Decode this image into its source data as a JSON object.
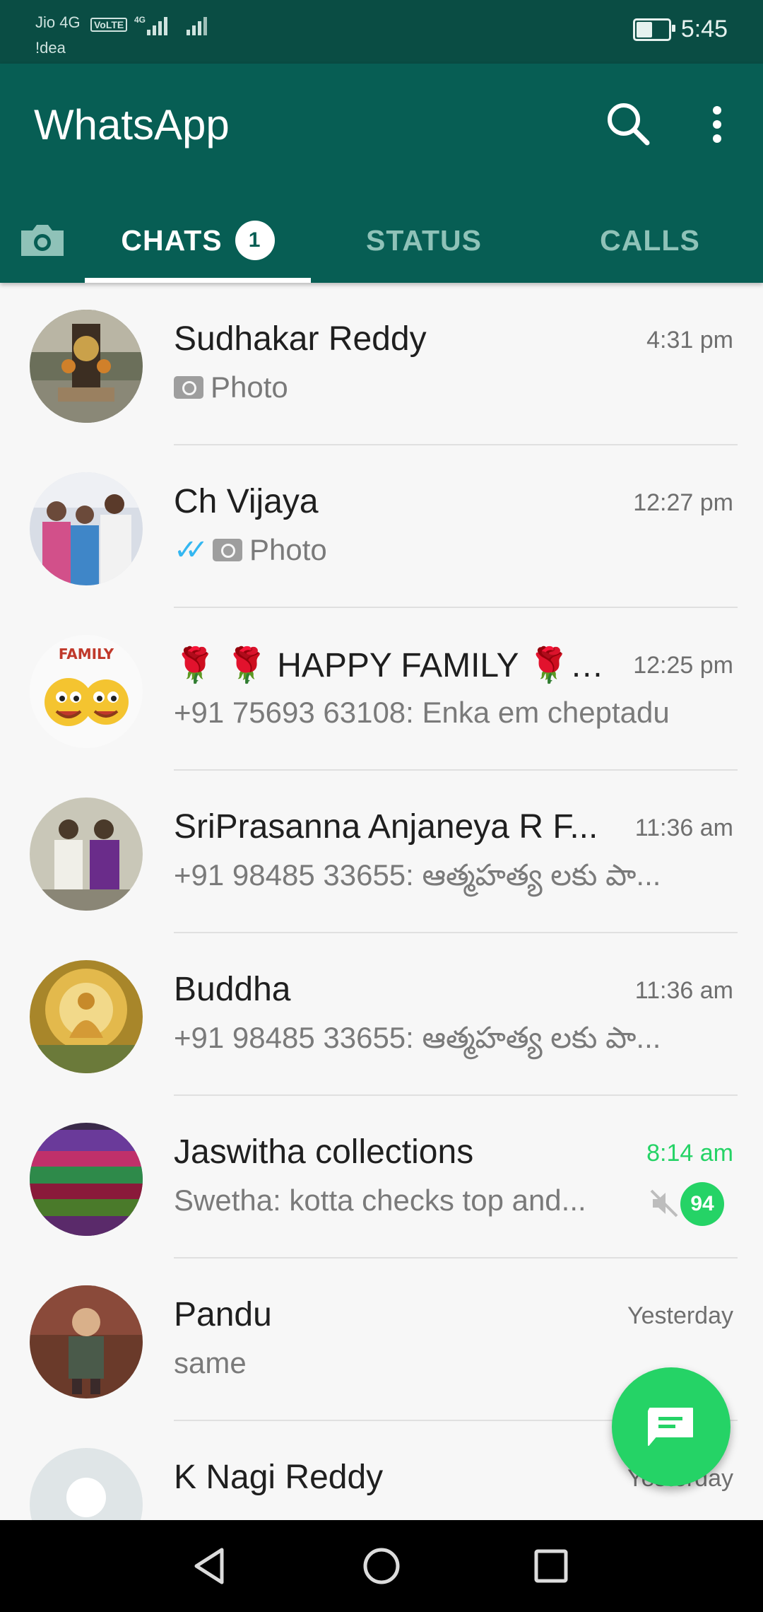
{
  "status_bar": {
    "carrier_1": "Jio 4G",
    "volte": "VoLTE",
    "net_type": "4G",
    "carrier_2": "!dea",
    "time": "5:45",
    "battery_level": 0.55
  },
  "app_bar": {
    "title": "WhatsApp",
    "search_icon": "search-icon",
    "menu_icon": "more-vert-icon"
  },
  "tabs": {
    "camera_icon": "camera-icon",
    "items": [
      {
        "label": "CHATS",
        "badge": "1",
        "active": true
      },
      {
        "label": "STATUS",
        "active": false
      },
      {
        "label": "CALLS",
        "active": false
      }
    ]
  },
  "chats": [
    {
      "name": "Sudhakar Reddy",
      "time": "4:31 pm",
      "preview": "Photo",
      "photo": true,
      "ticks": false
    },
    {
      "name": "Ch Vijaya",
      "time": "12:27 pm",
      "preview": "Photo",
      "photo": true,
      "ticks": true
    },
    {
      "name": "🌹 🌹 HAPPY FAMILY 🌹 🌹",
      "time": "12:25 pm",
      "preview": "+91 75693 63108: Enka em cheptadu",
      "photo": false,
      "ticks": false
    },
    {
      "name": "SriPrasanna Anjaneya R F...",
      "time": "11:36 am",
      "preview": "+91 98485 33655: ఆత్మహత్య లకు పా...",
      "photo": false,
      "ticks": false
    },
    {
      "name": "Buddha",
      "time": "11:36 am",
      "preview": "+91 98485 33655: ఆత్మహత్య లకు పా...",
      "photo": false,
      "ticks": false
    },
    {
      "name": "Jaswitha collections",
      "time": "8:14 am",
      "preview": "Swetha: kotta checks top and...",
      "photo": false,
      "ticks": false,
      "muted": true,
      "unread": "94"
    },
    {
      "name": "Pandu",
      "time": "Yesterday",
      "preview": "same",
      "photo": false,
      "ticks": false
    },
    {
      "name": "K Nagi Reddy",
      "time": "Yesterday",
      "preview": "",
      "photo": false,
      "ticks": false
    }
  ],
  "fab": {
    "icon": "new-chat-icon"
  },
  "nav_bar": {
    "back_icon": "back-icon",
    "home_icon": "home-icon",
    "recents_icon": "recents-icon"
  },
  "colors": {
    "primary": "#075e54",
    "status_bar": "#0a4d44",
    "accent": "#25d366",
    "tick_blue": "#34b7f1"
  }
}
